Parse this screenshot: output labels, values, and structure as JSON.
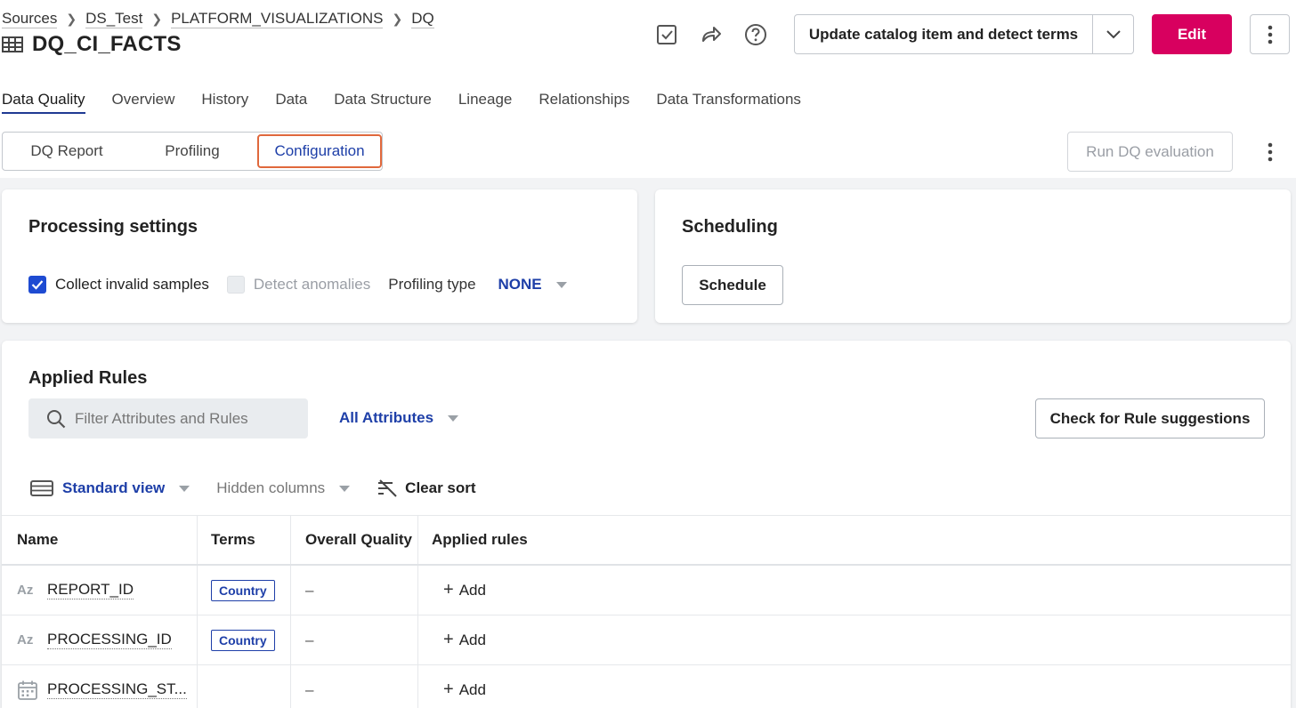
{
  "breadcrumb": [
    "Sources",
    "DS_Test",
    "PLATFORM_VISUALIZATIONS",
    "DQ"
  ],
  "title": "DQ_CI_FACTS",
  "header_actions": {
    "split_button_label": "Update catalog item and detect terms",
    "edit_label": "Edit",
    "icons": [
      "checkbox-icon",
      "share-icon",
      "help-icon",
      "chevron-down-icon",
      "more-vertical-icon"
    ]
  },
  "tabs": [
    {
      "label": "Data Quality",
      "active": true
    },
    {
      "label": "Overview"
    },
    {
      "label": "History"
    },
    {
      "label": "Data"
    },
    {
      "label": "Data Structure"
    },
    {
      "label": "Lineage"
    },
    {
      "label": "Relationships"
    },
    {
      "label": "Data Transformations"
    }
  ],
  "subtabs": [
    {
      "label": "DQ Report"
    },
    {
      "label": "Profiling"
    },
    {
      "label": "Configuration",
      "active": true
    }
  ],
  "run_dq_label": "Run DQ evaluation",
  "processing": {
    "title": "Processing settings",
    "collect_invalid_samples": {
      "label": "Collect invalid samples",
      "checked": true
    },
    "detect_anomalies": {
      "label": "Detect anomalies",
      "checked": false,
      "disabled": true
    },
    "profiling_type_label": "Profiling type",
    "profiling_type_value": "NONE"
  },
  "scheduling": {
    "title": "Scheduling",
    "schedule_label": "Schedule"
  },
  "applied_rules": {
    "title": "Applied Rules",
    "search_placeholder": "Filter Attributes and Rules",
    "attribute_filter": "All Attributes",
    "suggestions_label": "Check for Rule suggestions",
    "view_label": "Standard view",
    "hidden_columns_label": "Hidden columns",
    "clear_sort_label": "Clear sort"
  },
  "table": {
    "columns": [
      "Name",
      "Terms",
      "Overall Quality",
      "Applied rules"
    ],
    "rows": [
      {
        "type_icon": "Az",
        "name": "REPORT_ID",
        "term": "Country",
        "quality": "–",
        "add_label": "Add"
      },
      {
        "type_icon": "Az",
        "name": "PROCESSING_ID",
        "term": "Country",
        "quality": "–",
        "add_label": "Add"
      },
      {
        "type_icon": "calendar",
        "name": "PROCESSING_ST...",
        "term": "",
        "quality": "–",
        "add_label": "Add"
      }
    ]
  },
  "colors": {
    "accent": "#1e3fa8",
    "edit": "#d8005f",
    "highlight": "#e0683c"
  }
}
